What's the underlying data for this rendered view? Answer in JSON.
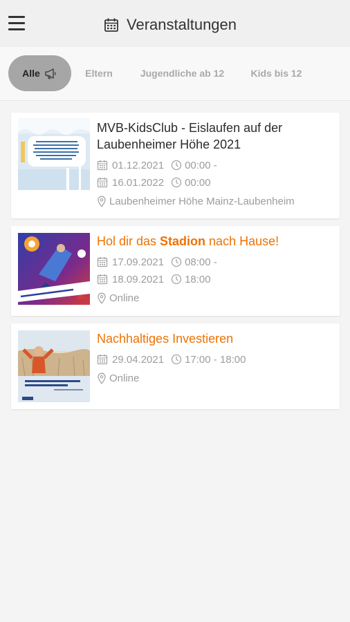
{
  "header": {
    "title": "Veranstaltungen",
    "menu_icon": "hamburger-menu-icon",
    "title_icon": "calendar-icon"
  },
  "tabs": [
    {
      "label": "Alle",
      "active": true,
      "icon": "megaphone-icon"
    },
    {
      "label": "Eltern",
      "active": false
    },
    {
      "label": "Jugendliche ab 12",
      "active": false
    },
    {
      "label": "Kids bis 12",
      "active": false
    }
  ],
  "events": [
    {
      "title": "MVB-KidsClub - Eislaufen auf der Laubenheimer Höhe 2021",
      "start_date": "01.12.2021",
      "start_time": "00:00 -",
      "end_date": "16.01.2022",
      "end_time": "00:00",
      "location": "Laubenheimer Höhe Mainz-Laubenheim",
      "title_color": "#2b2b2b"
    },
    {
      "title_parts": {
        "before": "Hol dir das ",
        "bold": "Stadion",
        "after": " nach Hause!"
      },
      "start_date": "17.09.2021",
      "start_time": "08:00 -",
      "end_date": "18.09.2021",
      "end_time": "18:00",
      "location": "Online",
      "title_color": "#ee7203"
    },
    {
      "title": "Nachhaltiges Investieren",
      "date": "29.04.2021",
      "time": "17:00 - 18:00",
      "location": "Online",
      "title_color": "#ee7203"
    }
  ],
  "colors": {
    "accent": "#ee7203",
    "active_tab": "#a6a6a6",
    "meta_text": "#9c9c9c"
  }
}
